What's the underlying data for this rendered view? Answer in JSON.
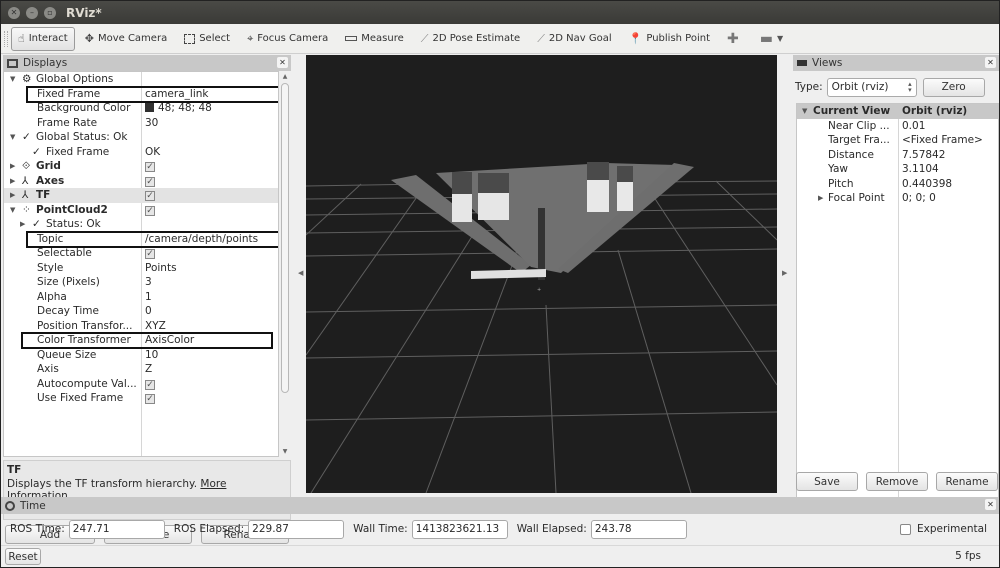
{
  "window": {
    "title": "RViz*",
    "controls": [
      "close",
      "minimize",
      "maximize"
    ]
  },
  "toolbar": {
    "tools": [
      {
        "label": "Interact",
        "icon": "hand-pointer-icon",
        "active": true
      },
      {
        "label": "Move Camera",
        "icon": "move-camera-icon",
        "active": false
      },
      {
        "label": "Select",
        "icon": "select-rect-icon",
        "active": false
      },
      {
        "label": "Focus Camera",
        "icon": "focus-camera-icon",
        "active": false
      },
      {
        "label": "Measure",
        "icon": "ruler-icon",
        "active": false
      },
      {
        "label": "2D Pose Estimate",
        "icon": "pose-arrow-icon",
        "active": false
      },
      {
        "label": "2D Nav Goal",
        "icon": "nav-arrow-icon",
        "active": false
      },
      {
        "label": "Publish Point",
        "icon": "map-pin-icon",
        "active": false
      }
    ]
  },
  "displays": {
    "title": "Displays",
    "rows": [
      {
        "name": "Global Options",
        "value": "",
        "indent": 0,
        "arrow": "down",
        "icon": "gear",
        "bold": false
      },
      {
        "name": "Fixed Frame",
        "value": "camera_link",
        "indent": 1,
        "highlight": true
      },
      {
        "name": "Background Color",
        "value": "48; 48; 48",
        "indent": 1,
        "swatch": "#303030"
      },
      {
        "name": "Frame Rate",
        "value": "30",
        "indent": 1
      },
      {
        "name": "Global Status: Ok",
        "value": "",
        "indent": 0,
        "arrow": "down",
        "icon": "check"
      },
      {
        "name": "Fixed Frame",
        "value": "OK",
        "indent": 1,
        "icon": "check"
      },
      {
        "name": "Grid",
        "value": "checked",
        "indent": 0,
        "arrow": "right",
        "icon": "grid",
        "bold": true
      },
      {
        "name": "Axes",
        "value": "checked",
        "indent": 0,
        "arrow": "right",
        "icon": "axes",
        "bold": true
      },
      {
        "name": "TF",
        "value": "checked",
        "indent": 0,
        "arrow": "right",
        "icon": "tf",
        "bold": true,
        "selected": true
      },
      {
        "name": "PointCloud2",
        "value": "checked",
        "indent": 0,
        "arrow": "down",
        "icon": "pointcloud",
        "bold": true
      },
      {
        "name": "Status: Ok",
        "value": "",
        "indent": 1,
        "arrow": "right",
        "icon": "check"
      },
      {
        "name": "Topic",
        "value": "/camera/depth/points",
        "indent": 1,
        "highlight": true
      },
      {
        "name": "Selectable",
        "value": "checked",
        "indent": 1
      },
      {
        "name": "Style",
        "value": "Points",
        "indent": 1
      },
      {
        "name": "Size (Pixels)",
        "value": "3",
        "indent": 1
      },
      {
        "name": "Alpha",
        "value": "1",
        "indent": 1
      },
      {
        "name": "Decay Time",
        "value": "0",
        "indent": 1
      },
      {
        "name": "Position Transfor...",
        "value": "XYZ",
        "indent": 1
      },
      {
        "name": "Color Transformer",
        "value": "AxisColor",
        "indent": 1,
        "highlight": true
      },
      {
        "name": "Queue Size",
        "value": "10",
        "indent": 1
      },
      {
        "name": "Axis",
        "value": "Z",
        "indent": 1
      },
      {
        "name": "Autocompute Val...",
        "value": "checked",
        "indent": 1
      },
      {
        "name": "Use Fixed Frame",
        "value": "checked",
        "indent": 1
      }
    ],
    "description": {
      "title": "TF",
      "text": "Displays the TF transform hierarchy.",
      "link": "More Information."
    },
    "buttons": {
      "add": "Add",
      "remove": "Remove",
      "rename": "Rename"
    }
  },
  "views": {
    "title": "Views",
    "type_label": "Type:",
    "type_value": "Orbit (rviz)",
    "zero_button": "Zero",
    "header": {
      "name": "Current View",
      "value": "Orbit (rviz)"
    },
    "rows": [
      {
        "name": "Near Clip ...",
        "value": "0.01"
      },
      {
        "name": "Target Fra...",
        "value": "<Fixed Frame>"
      },
      {
        "name": "Distance",
        "value": "7.57842"
      },
      {
        "name": "Yaw",
        "value": "3.1104"
      },
      {
        "name": "Pitch",
        "value": "0.440398"
      },
      {
        "name": "Focal Point",
        "value": "0; 0; 0",
        "arrow": "right"
      }
    ],
    "buttons": {
      "save": "Save",
      "remove": "Remove",
      "rename": "Rename"
    }
  },
  "time": {
    "title": "Time",
    "ros_time_label": "ROS Time:",
    "ros_time": "247.71",
    "ros_elapsed_label": "ROS Elapsed:",
    "ros_elapsed": "229.87",
    "wall_time_label": "Wall Time:",
    "wall_time": "1413823621.13",
    "wall_elapsed_label": "Wall Elapsed:",
    "wall_elapsed": "243.78",
    "experimental_label": "Experimental",
    "experimental_checked": false,
    "reset_button": "Reset",
    "fps": "5 fps"
  },
  "colors": {
    "viewport_bg": "#1e1e1e",
    "grid_line": "#6a6a6a",
    "panel_header": "#c8c8c8",
    "highlight_box": "#111111"
  }
}
